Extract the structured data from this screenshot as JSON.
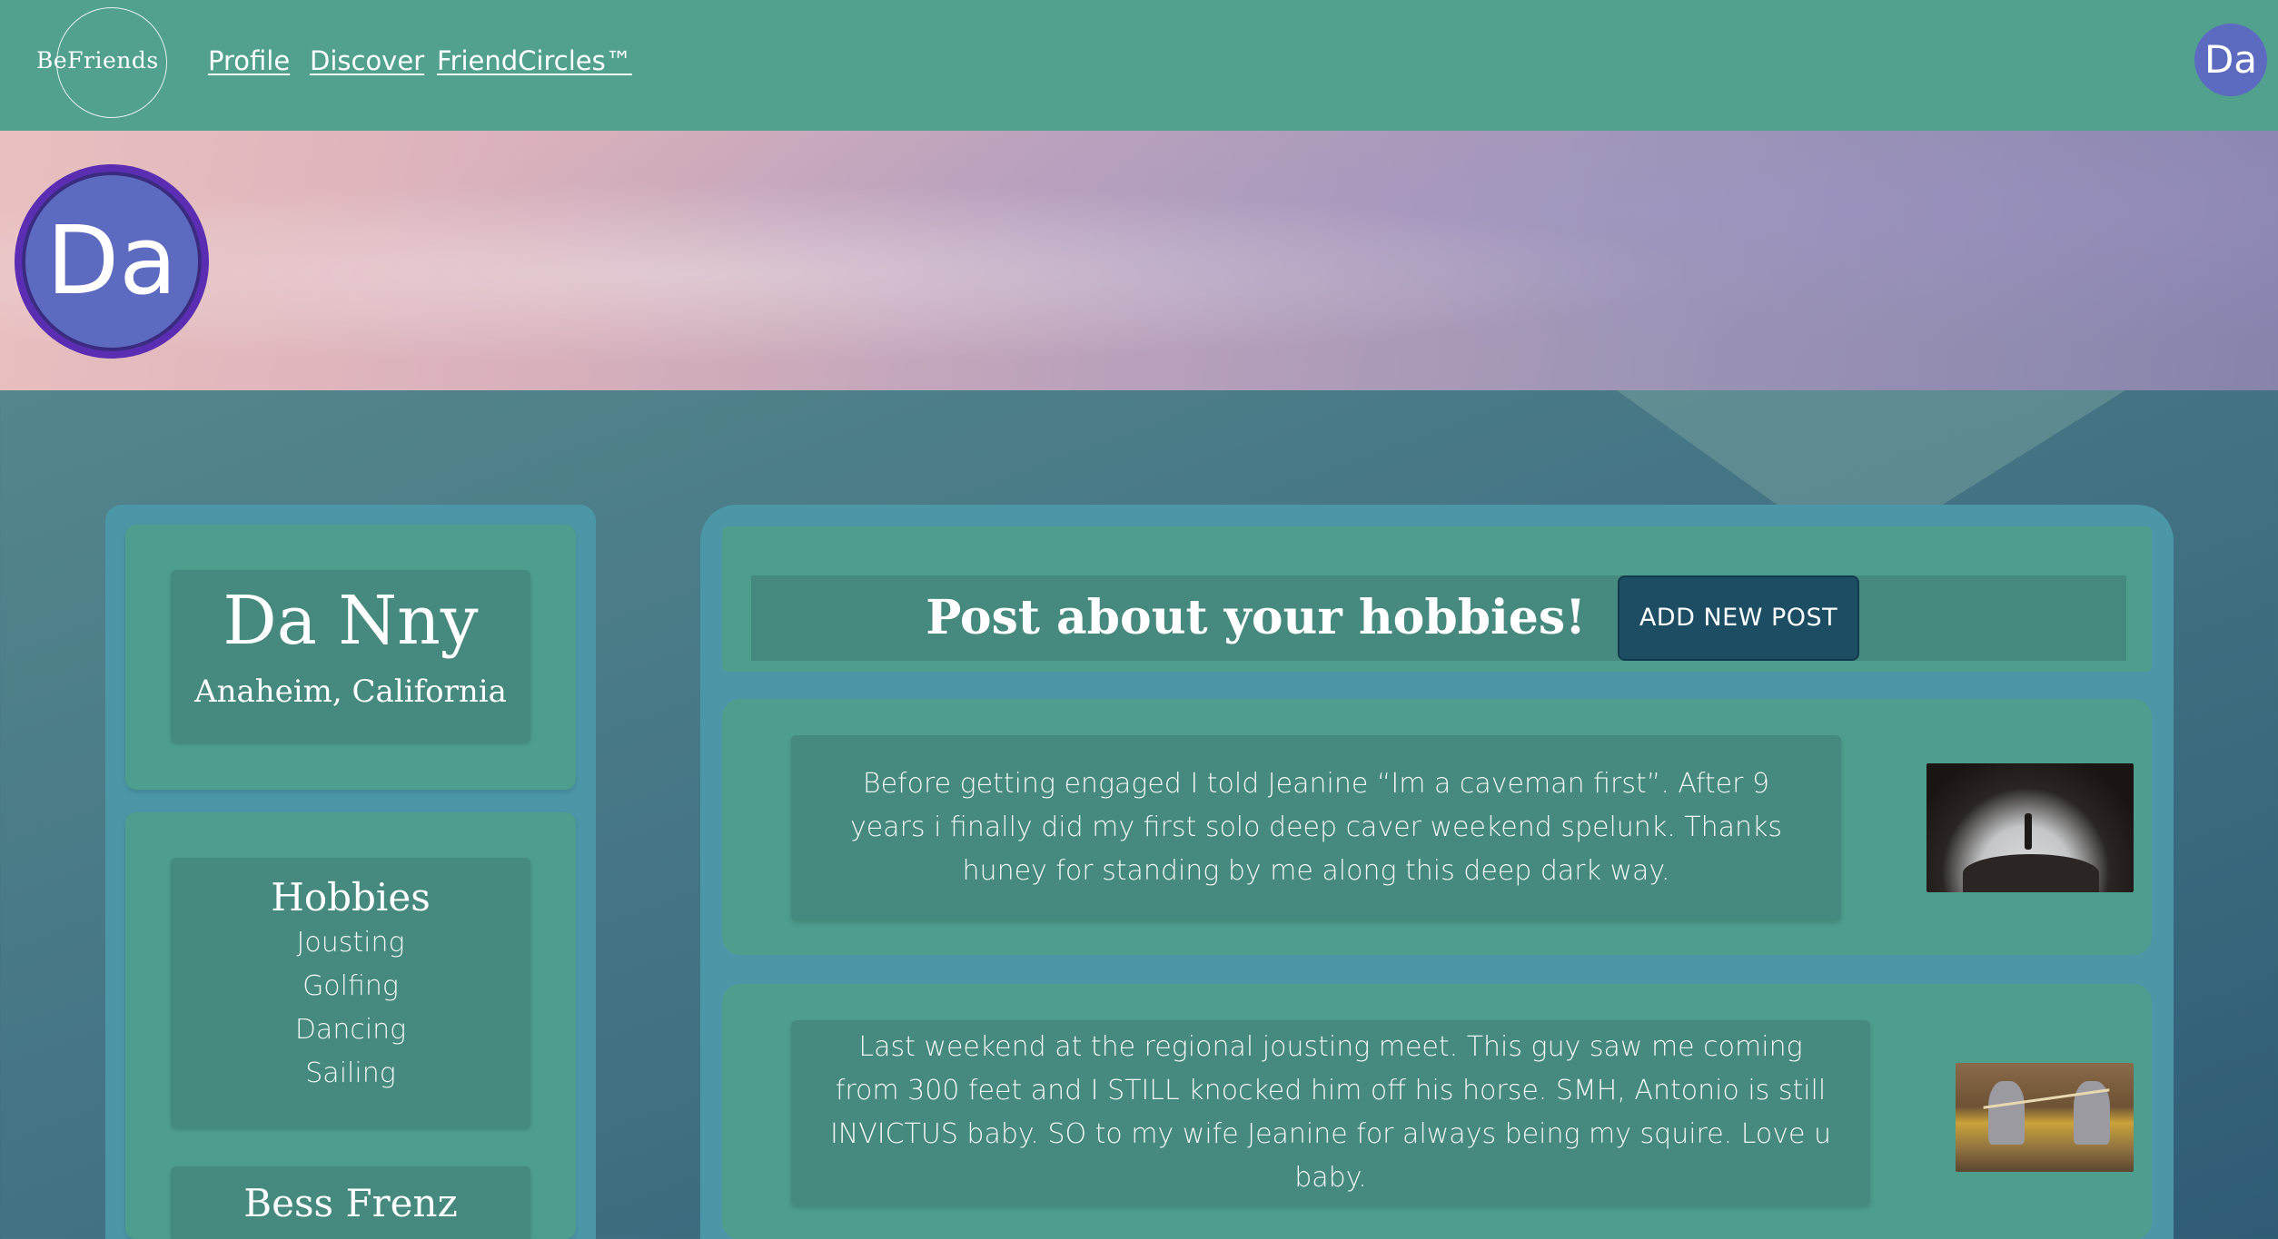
{
  "header": {
    "logo": "BeFriends",
    "nav": [
      {
        "label": "Profile"
      },
      {
        "label": "Discover"
      },
      {
        "label": "FriendCircles™"
      }
    ],
    "avatar_initials": "Da"
  },
  "banner": {
    "avatar_initials": "Da"
  },
  "profile": {
    "name": "Da Nny",
    "location": "Anaheim, California"
  },
  "hobbies": {
    "title": "Hobbies",
    "items": [
      "Jousting",
      "Golfing",
      "Dancing",
      "Sailing"
    ]
  },
  "friends": {
    "first_name_visible": "Bess Frenz"
  },
  "feed": {
    "header_title": "Post about your hobbies!",
    "add_post_label": "ADD NEW POST",
    "posts": [
      {
        "text": "Before getting engaged I told Jeanine “Im a caveman first”. After 9 years i finally did my first solo deep caver weekend spelunk. Thanks huney for standing by me along this deep dark way.",
        "image": "cave-photo"
      },
      {
        "text": "Last weekend at the regional jousting meet. This guy saw me coming from 300 feet and I STILL knocked him off his horse. SMH, Antonio is still INVICTUS baby. SO to my wife Jeanine for always being my squire. Love u baby.",
        "image": "jousting-photo"
      }
    ]
  },
  "colors": {
    "topbar": "#52a18f",
    "avatar": "#5c6bc0",
    "avatar_ring": "#5a2db2",
    "panel": "#4b97a8",
    "card": "#4e9e8e",
    "inner_card": "#46897e",
    "button": "#1d4d63"
  }
}
